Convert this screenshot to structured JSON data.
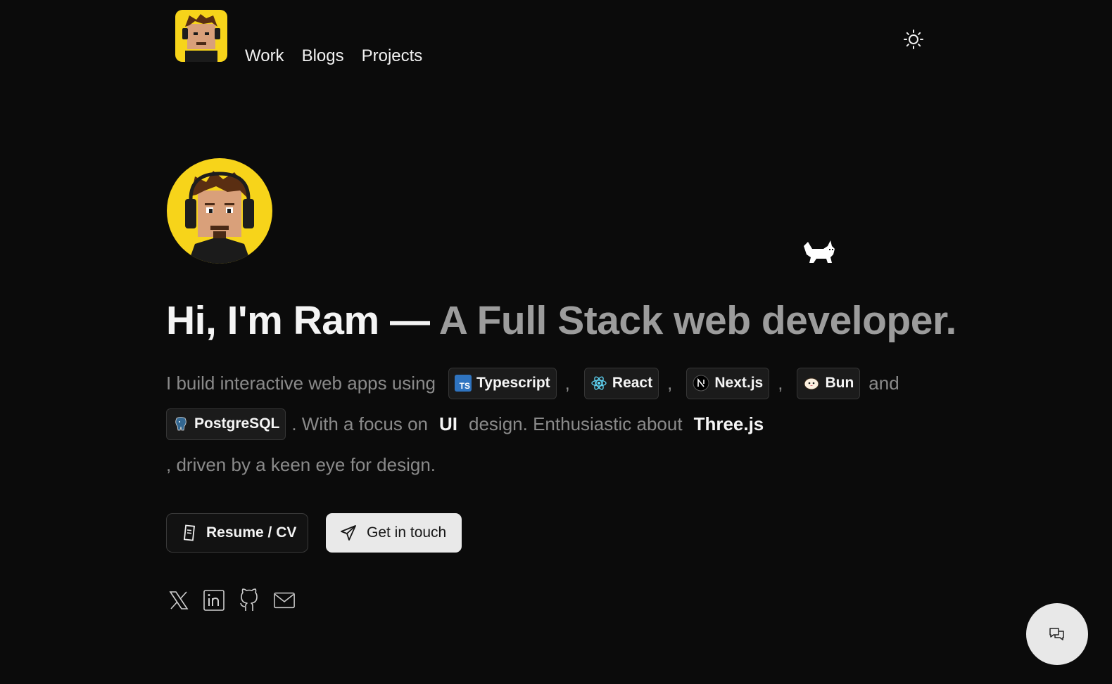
{
  "nav": {
    "items": [
      {
        "label": "Work"
      },
      {
        "label": "Blogs"
      },
      {
        "label": "Projects"
      }
    ]
  },
  "hero": {
    "headline_lead": "Hi, I'm Ram —",
    "headline_accent": "A Full Stack web developer.",
    "intro_prefix": "I build interactive web apps using",
    "techs": [
      {
        "label": "Typescript",
        "icon": "typescript-icon"
      },
      {
        "label": "React",
        "icon": "react-icon"
      },
      {
        "label": "Next.js",
        "icon": "nextjs-icon"
      },
      {
        "label": "Bun",
        "icon": "bun-icon"
      },
      {
        "label": "PostgreSQL",
        "icon": "postgresql-icon"
      }
    ],
    "comma": ",",
    "and": "and",
    "focus_prefix": ". With a focus on",
    "focus_word": "UI",
    "enthusiastic_prefix": "design. Enthusiastic about",
    "enthusiastic_word": "Three.js",
    "closing": ", driven by a keen eye for design."
  },
  "actions": {
    "resume_label": "Resume / CV",
    "contact_label": "Get in touch"
  },
  "colors": {
    "background": "#0b0b0b",
    "avatar_bg": "#f7d41a",
    "accent_text": "#9c9c9c"
  }
}
